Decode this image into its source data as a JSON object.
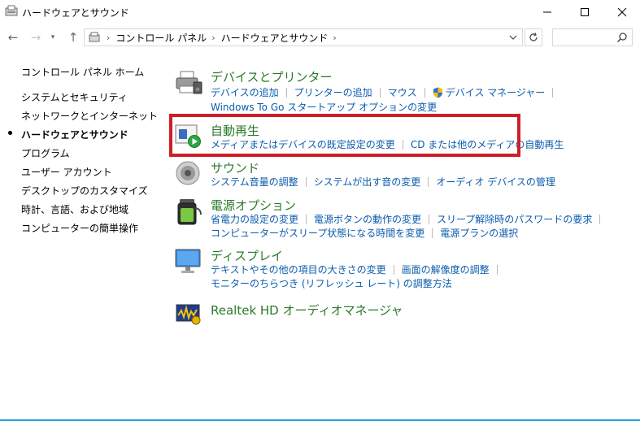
{
  "window": {
    "title": "ハードウェアとサウンド",
    "icon": "control-panel-icon"
  },
  "navigation": {
    "address_sep_lead": "›",
    "breadcrumbs": [
      {
        "label": "コントロール パネル",
        "sep": "›"
      },
      {
        "label": "ハードウェアとサウンド",
        "sep": "›"
      }
    ],
    "search_placeholder": ""
  },
  "sidebar": {
    "items": [
      {
        "label": "コントロール パネル ホーム",
        "active": false
      },
      {
        "label": "システムとセキュリティ",
        "active": false
      },
      {
        "label": "ネットワークとインターネット",
        "active": false
      },
      {
        "label": "ハードウェアとサウンド",
        "active": true
      },
      {
        "label": "プログラム",
        "active": false
      },
      {
        "label": "ユーザー アカウント",
        "active": false
      },
      {
        "label": "デスクトップのカスタマイズ",
        "active": false
      },
      {
        "label": "時計、言語、および地域",
        "active": false
      },
      {
        "label": "コンピューターの簡単操作",
        "active": false
      }
    ]
  },
  "categories": [
    {
      "title": "デバイスとプリンター",
      "icon": "printer-icon",
      "links": [
        [
          "デバイスの追加",
          "プリンターの追加",
          "マウス",
          "デバイス マネージャー"
        ],
        [
          "Windows To Go スタートアップ オプションの変更"
        ]
      ]
    },
    {
      "title": "自動再生",
      "icon": "autoplay-icon",
      "links": [
        [
          "メディアまたはデバイスの既定設定の変更",
          "CD または他のメディアの自動再生"
        ]
      ]
    },
    {
      "title": "サウンド",
      "icon": "speaker-icon",
      "links": [
        [
          "システム音量の調整",
          "システムが出す音の変更",
          "オーディオ デバイスの管理"
        ]
      ]
    },
    {
      "title": "電源オプション",
      "icon": "battery-icon",
      "links": [
        [
          "省電力の設定の変更",
          "電源ボタンの動作の変更",
          "スリープ解除時のパスワードの要求"
        ],
        [
          "コンピューターがスリープ状態になる時間を変更",
          "電源プランの選択"
        ]
      ]
    },
    {
      "title": "ディスプレイ",
      "icon": "monitor-icon",
      "links": [
        [
          "テキストやその他の項目の大きさの変更",
          "画面の解像度の調整"
        ],
        [
          "モニターのちらつき (リフレッシュ レート) の調整方法"
        ]
      ]
    },
    {
      "title": "Realtek HD オーディオマネージャ",
      "icon": "realtek-audio-icon",
      "links": []
    }
  ],
  "colors": {
    "category_title": "#2a7a2a",
    "link": "#0b5cad",
    "highlight": "#cc1f2a"
  }
}
